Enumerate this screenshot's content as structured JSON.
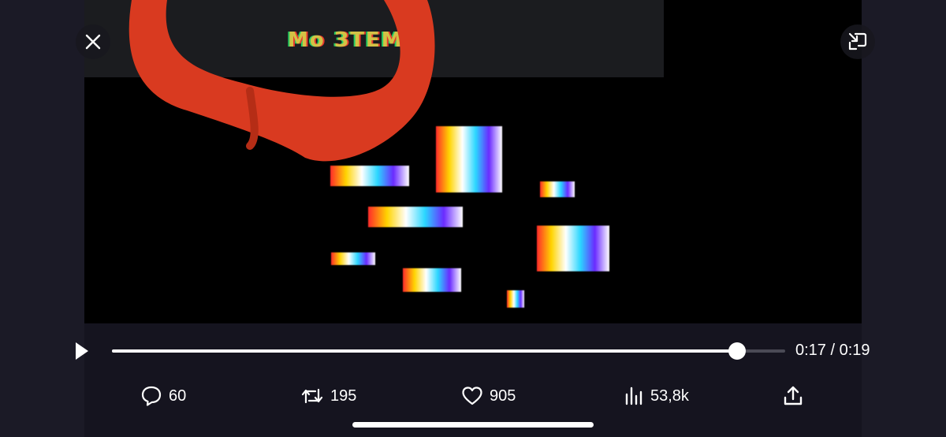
{
  "player": {
    "overlay_text": "Мо ЗТЕМА",
    "progress": 0.929,
    "time_display": "0:17 / 0:19",
    "close_icon": "close-icon",
    "restore_icon": "exit-fullscreen-icon",
    "play_icon": "play-icon"
  },
  "actions": {
    "replies": {
      "icon": "reply-icon",
      "count": "60"
    },
    "reposts": {
      "icon": "repost-icon",
      "count": "195"
    },
    "likes": {
      "icon": "heart-icon",
      "count": "905"
    },
    "views": {
      "icon": "views-chart-icon",
      "count": "53,8k"
    },
    "share": {
      "icon": "share-icon"
    }
  },
  "colors": {
    "background": "#15141f",
    "video_background": "#000000",
    "annotation_red": "#d93a20",
    "foreground": "#ffffff",
    "seek_track": "#4a4a55"
  }
}
